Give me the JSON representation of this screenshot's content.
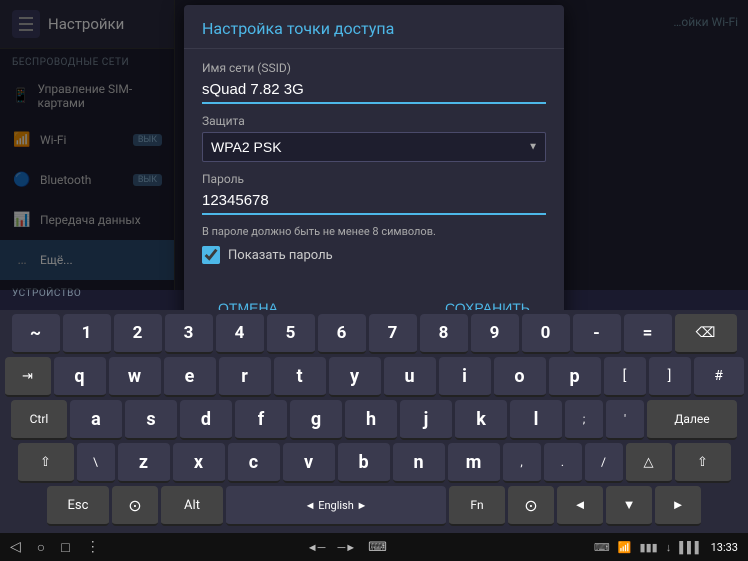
{
  "app": {
    "title": "Настройки"
  },
  "sidebar": {
    "sections": [
      {
        "label": "БЕСПРОВОДНЫЕ СЕТИ",
        "items": [
          {
            "id": "sim",
            "icon": "📱",
            "label": "Управление SIM-картами",
            "badge": null
          },
          {
            "id": "wifi",
            "icon": "📶",
            "label": "Wi-Fi",
            "badge": "ВЫК",
            "active": false
          },
          {
            "id": "bluetooth",
            "icon": "🔵",
            "label": "Bluetooth",
            "badge": "ВЫК",
            "active": false
          },
          {
            "id": "data",
            "icon": "📊",
            "label": "Передача данных",
            "badge": null,
            "active": false
          },
          {
            "id": "more",
            "icon": "",
            "label": "Ещё...",
            "badge": null,
            "active": true
          }
        ]
      },
      {
        "label": "УСТРОЙСТВО",
        "items": []
      }
    ]
  },
  "dialog": {
    "title": "Настройка точки доступа",
    "ssid_label": "Имя сети (SSID)",
    "ssid_value": "sQuad 7.82 3G",
    "security_label": "Защита",
    "security_value": "WPA2 PSK",
    "password_label": "Пароль",
    "password_value": "12345678",
    "hint_text": "В пароле должно быть не менее 8 символов.",
    "show_password_label": "Показать пароль",
    "cancel_label": "Отмена",
    "save_label": "Сохранить"
  },
  "keyboard": {
    "rows": [
      [
        "~",
        "1",
        "2",
        "3",
        "4",
        "5",
        "6",
        "7",
        "8",
        "9",
        "0",
        "-",
        "=",
        "⌫"
      ],
      [
        "⇥",
        "q",
        "w",
        "e",
        "r",
        "t",
        "y",
        "u",
        "i",
        "o",
        "p",
        "[",
        "]",
        "#"
      ],
      [
        "Ctrl",
        "a",
        "s",
        "d",
        "f",
        "g",
        "h",
        "j",
        "k",
        "l",
        ";",
        "'",
        "Далее"
      ],
      [
        "⇧",
        "\\",
        "z",
        "x",
        "c",
        "v",
        "b",
        "n",
        "m",
        ",",
        ".",
        "/",
        "△",
        "⇧"
      ],
      [
        "Esc",
        "⊙",
        "Alt",
        "◄ English ►",
        "Fn",
        "⊙",
        "◄",
        "▼",
        "►"
      ]
    ],
    "language": "English"
  },
  "navbar": {
    "back_icon": "◁",
    "home_icon": "○",
    "recent_icon": "□",
    "menu_icon": "⋮",
    "volume_down": "◄",
    "volume_up": "►",
    "keyboard_icon": "⌨",
    "wifi_status": "📶",
    "battery_icon": "🔋",
    "time": "13:33"
  }
}
